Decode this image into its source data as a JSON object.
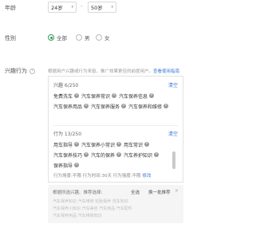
{
  "age": {
    "label": "年龄",
    "from": "24岁",
    "to": "50岁",
    "separator": "-"
  },
  "gender": {
    "label": "性别",
    "options": [
      "全部",
      "男",
      "女"
    ],
    "selected": "全部"
  },
  "interest": {
    "label": "兴趣行为",
    "hint": "根据用户兴趣或行为来投，推广效果更佳的前提用户。",
    "hint_link": "查看使用指南",
    "interest_section": {
      "title": "兴趣 6/250",
      "clear": "清空",
      "tags": [
        "免费洗车",
        "汽车保养常识",
        "汽车保养信息",
        "汽车保养用品",
        "汽车保养服务",
        "汽车保养和维修"
      ]
    },
    "behavior_section": {
      "title": "行为 13/250",
      "clear": "清空",
      "tags": [
        "用车指导",
        "汽车保养小常识",
        "用车常识",
        "汽车保养技巧",
        "汽车的保养",
        "汽车养护知识",
        "保养指导"
      ]
    },
    "footer": {
      "text": "行为场景:不限 行为时间:30天 行为强度:不限",
      "edit": "修改"
    },
    "recommend": {
      "title": "根据所选兴趣、推荐选择:",
      "select_all": "全选",
      "replace": "换一批推荐",
      "close": "×",
      "lines": [
        "汽车保养知识 汽车维修 轮胎保养 洗车知识",
        "汽车保养小知识 汽车美容 汽车用品 汽车配件",
        "汽车保养用品 汽车维修知识"
      ]
    }
  },
  "colors": {
    "accent_green": "#2e9d5b",
    "link_blue": "#3b79d6"
  }
}
